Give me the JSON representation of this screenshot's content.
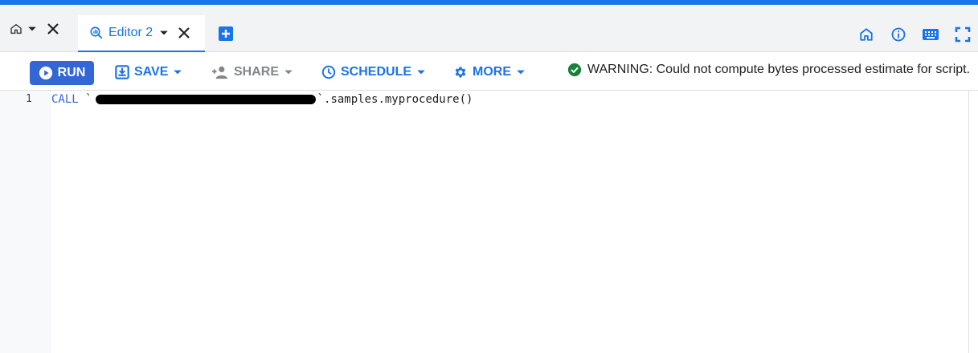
{
  "tabs": {
    "home_tab": {},
    "active_tab": {
      "label": "Editor 2"
    }
  },
  "toolbar": {
    "run_label": "RUN",
    "save_label": "SAVE",
    "share_label": "SHARE",
    "schedule_label": "SCHEDULE",
    "more_label": "MORE"
  },
  "status": {
    "message": "WARNING: Could not compute bytes processed estimate for script.",
    "icon": "check-circle-icon",
    "color": "#188038"
  },
  "editor": {
    "lines": [
      {
        "number": "1",
        "keyword": "CALL",
        "open_quote": " `",
        "close_quote": "`",
        "rest": ".samples.myprocedure()"
      }
    ]
  },
  "colors": {
    "accent": "#1a73e8",
    "run_button": "#3367d6",
    "disabled": "#80868b"
  }
}
